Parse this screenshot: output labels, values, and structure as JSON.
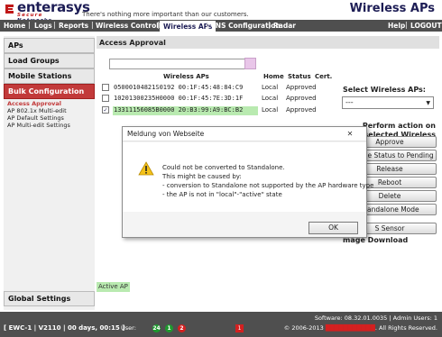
{
  "header": {
    "logo_text": "enterasys",
    "logo_sub_red": "Secure",
    "logo_sub_blue": "Networks",
    "tagline": "There's nothing more important than our customers.",
    "app_title": "Wireless APs"
  },
  "nav": {
    "home": "Home",
    "logs": "Logs",
    "reports": "Reports",
    "wireless_controller": "Wireless Controller",
    "wireless_aps": "Wireless APs",
    "vns_configuration": "VNS Configuration",
    "radar": "Radar",
    "help": "Help",
    "logout": "LOGOUT",
    "separator": "|"
  },
  "sidebar": {
    "aps": "APs",
    "load_groups": "Load Groups",
    "mobile_stations": "Mobile Stations",
    "bulk_configuration": "Bulk Configuration",
    "sub_items": [
      "Access Approval",
      "AP 802.1x Multi-edit",
      "AP Default Settings",
      "AP Multi-edit Settings"
    ],
    "global_settings": "Global Settings"
  },
  "main": {
    "title": "Access Approval",
    "table": {
      "headers": {
        "aps": "Wireless APs",
        "home": "Home",
        "status": "Status",
        "cert": "Cert."
      },
      "rows": [
        {
          "ap": "05000104821S0192 00:1F:45:48:84:C9",
          "home": "Local",
          "status": "Approved",
          "checked": "",
          "selected": false
        },
        {
          "ap": "10201300235H0000 00:1F:45:7E:3D:1F",
          "home": "Local",
          "status": "Approved",
          "checked": "",
          "selected": false
        },
        {
          "ap": "13311156085B0000 20:B3:99:A9:BC:B2",
          "home": "Local",
          "status": "Approved",
          "checked": "✓",
          "selected": true
        }
      ]
    },
    "select_label": "Select Wireless APs:",
    "select_value": "---",
    "perform_label": "Perform action on selected Wireless AP(s):",
    "buttons": {
      "approve": "Approve",
      "change_status": "Change Status to Pending",
      "release": "Release",
      "reboot": "Reboot",
      "delete": "Delete",
      "standalone": "Standalone Mode",
      "sensor": "S Sensor"
    },
    "image_download": "mage Download",
    "active_ap_label": "Active AP"
  },
  "dialog": {
    "title": "Meldung von Webseite",
    "close_label": "✕",
    "lines": [
      "Could not be converted to Standalone.",
      "This might be caused by:",
      "- conversion to Standalone not supported by the AP hardware type",
      "- the AP is not in \"local\"-\"active\" state"
    ],
    "ok_label": "OK"
  },
  "footer": {
    "left": "[ EWC-1 | V2110 | 00 days, 00:15 ]",
    "user_label": "User:",
    "badge_green_1": "24",
    "badge_green_2": "1",
    "badge_red": "2",
    "alarm_badge": "1",
    "software": "Software: 08.32.01.0035 | Admin Users: 1",
    "copyright": "© 2006-2013",
    "rights": ". All Rights Reserved.",
    "colors": {
      "bar": "#4f4f4f",
      "green": "#1e9a2e",
      "red": "#d42020"
    }
  },
  "colors": {
    "accent": "#c23a3a",
    "nav": "#4f4f4f",
    "brand": "#1d1d55",
    "selected_row": "#b9eab0"
  }
}
